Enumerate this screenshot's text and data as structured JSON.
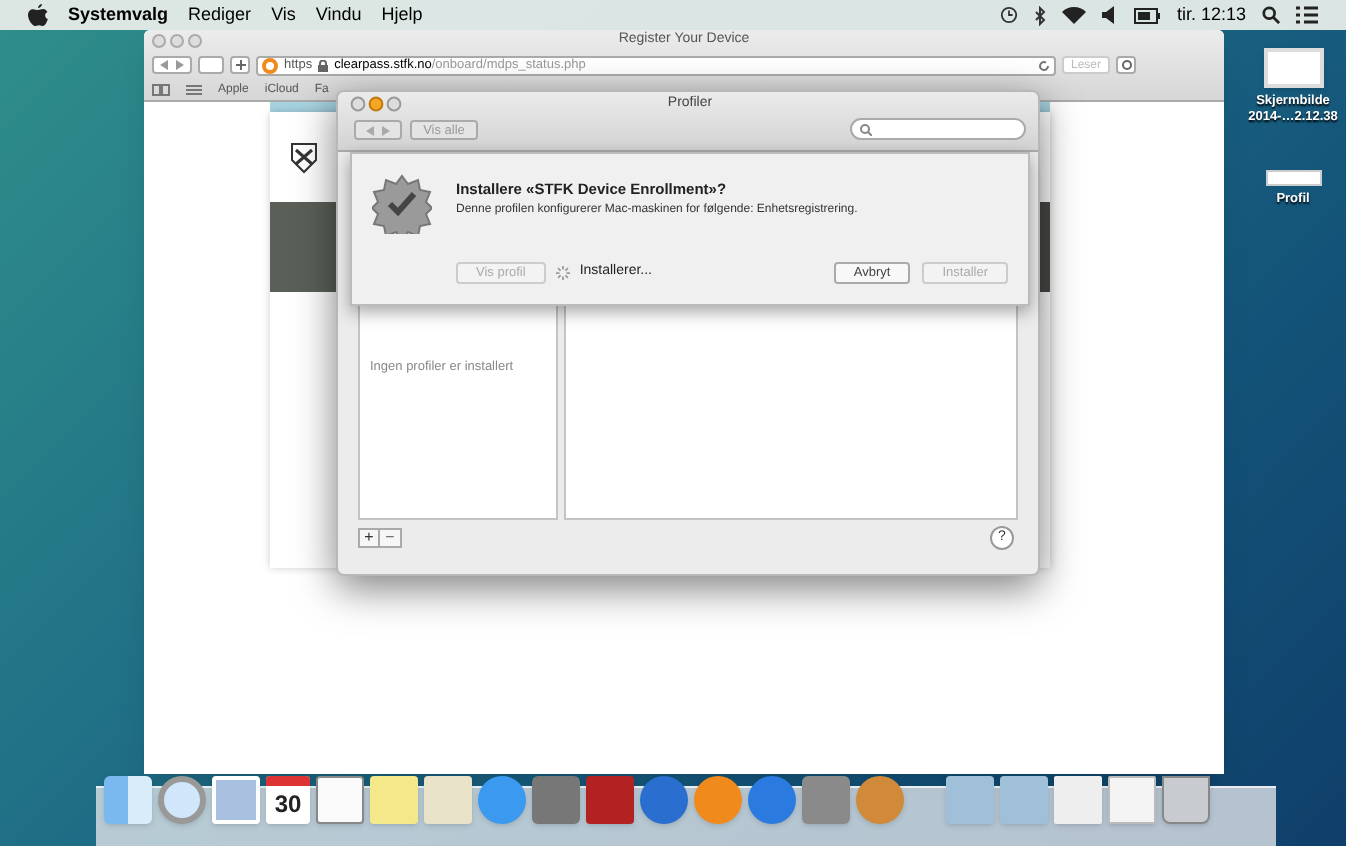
{
  "menubar": {
    "items": [
      {
        "label": "Systemvalg",
        "kind": "app"
      },
      {
        "label": "Rediger",
        "kind": "menu"
      },
      {
        "label": "Vis",
        "kind": "menu"
      },
      {
        "label": "Vindu",
        "kind": "menu"
      },
      {
        "label": "Hjelp",
        "kind": "menu"
      }
    ],
    "clock": "tir. 12:13"
  },
  "browser": {
    "title": "Register Your Device",
    "url_scheme": "https",
    "url_host": "clearpass.stfk.no",
    "url_path": "/onboard/mdps_status.php",
    "reader": "Leser",
    "bookmarks": [
      "Apple",
      "iCloud",
      "Fa"
    ]
  },
  "profiles_window": {
    "title": "Profiler",
    "show_all": "Vis alle",
    "sheet": {
      "title": "Installere «STFK Device Enrollment»?",
      "message": "Denne profilen konfigurerer Mac-maskinen for følgende: Enhetsregistrering.",
      "status": "Installerer...",
      "buttons": [
        {
          "label": "Vis profil",
          "kind": "left",
          "disabled": true
        },
        {
          "label": "Avbryt",
          "kind": "right",
          "disabled": false
        },
        {
          "label": "Installer",
          "kind": "right",
          "disabled": true
        }
      ]
    },
    "empty_text": "Ingen profiler er installert",
    "add": "+",
    "remove": "−",
    "help": "?"
  },
  "desktop_icons": [
    {
      "label": "Skjermbilde 2014-…2.12.38"
    },
    {
      "label": "Profil"
    }
  ],
  "dock": {
    "calendar_day": "30"
  }
}
